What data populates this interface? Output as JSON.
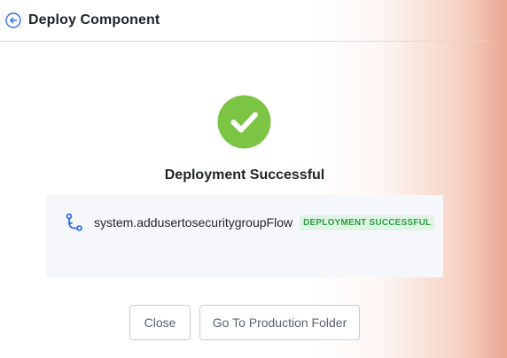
{
  "header": {
    "title": "Deploy Component",
    "back_icon": "back-arrow-circle-icon"
  },
  "status": {
    "icon": "check-circle-icon",
    "heading": "Deployment Successful",
    "color": "#7cc443"
  },
  "components": [
    {
      "icon": "flow-icon",
      "name": "system.addusertosecuritygroupFlow",
      "badge": "DEPLOYMENT SUCCESSFUL"
    }
  ],
  "actions": {
    "close_label": "Close",
    "production_label": "Go To Production Folder"
  },
  "colors": {
    "accent": "#2f6fe6",
    "badge_bg": "#dff5e3",
    "badge_text": "#2f9b45"
  }
}
